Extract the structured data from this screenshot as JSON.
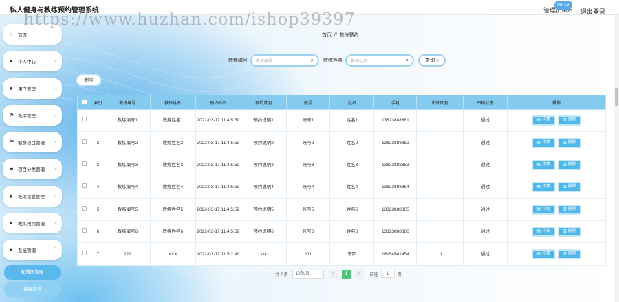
{
  "app": {
    "title": "私人健身与教练预约管理系统",
    "user_label": "管理员abo",
    "badge": "05:19",
    "logout": "退出登录",
    "watermark": "https://www.huzhan.com/ishop39397"
  },
  "sidebar": {
    "items": [
      {
        "label": "首页",
        "icon": "home-icon"
      },
      {
        "label": "个人中心",
        "icon": "person-icon"
      },
      {
        "label": "用户管理",
        "icon": "grid-icon"
      },
      {
        "label": "教练管理",
        "icon": "flag-icon"
      },
      {
        "label": "健身项目管理",
        "icon": "list-icon"
      },
      {
        "label": "项目分类管理",
        "icon": "box-icon"
      },
      {
        "label": "教练信息管理",
        "icon": "grid-icon"
      },
      {
        "label": "教练预约管理",
        "icon": "grid-icon"
      },
      {
        "label": "系统管理",
        "icon": "person-icon"
      }
    ],
    "sub_items": [
      "轮播图管理",
      "健身资讯"
    ]
  },
  "breadcrumb": {
    "home": "首页",
    "sep": "//",
    "current": "教练预约"
  },
  "search": {
    "label1": "教练编号",
    "placeholder1": "教练编号",
    "label2": "教练姓名",
    "placeholder2": "教练姓名",
    "query": "查询"
  },
  "toolbar": {
    "delete": "删除"
  },
  "table": {
    "headers": [
      "索引",
      "教练编号",
      "教练姓名",
      "预约时间",
      "预约说明",
      "账号",
      "姓名",
      "手机",
      "审核回复",
      "审核状态",
      "操作"
    ],
    "rows": [
      {
        "index": "1",
        "coach_no": "教练编号1",
        "coach_name": "教练姓名1",
        "time": "2022-03-17 11:4 5:59",
        "desc": "预约说明1",
        "account": "账号1",
        "name": "姓名1",
        "phone": "13823888881",
        "reply": "",
        "status": "通过"
      },
      {
        "index": "2",
        "coach_no": "教练编号2",
        "coach_name": "教练姓名2",
        "time": "2022-03-17 11:4 5:59",
        "desc": "预约说明2",
        "account": "账号2",
        "name": "姓名2",
        "phone": "13823888882",
        "reply": "",
        "status": "通过"
      },
      {
        "index": "3",
        "coach_no": "教练编号3",
        "coach_name": "教练姓名3",
        "time": "2022-03-17 11:4 5:59",
        "desc": "预约说明3",
        "account": "账号3",
        "name": "姓名3",
        "phone": "13823888883",
        "reply": "",
        "status": "通过"
      },
      {
        "index": "4",
        "coach_no": "教练编号4",
        "coach_name": "教练姓名4",
        "time": "2022-03-17 11:4 5:59",
        "desc": "预约说明4",
        "account": "账号4",
        "name": "姓名4",
        "phone": "13823888884",
        "reply": "",
        "status": "通过"
      },
      {
        "index": "5",
        "coach_no": "教练编号5",
        "coach_name": "教练姓名5",
        "time": "2022-03-17 11:4 5:59",
        "desc": "预约说明5",
        "account": "账号5",
        "name": "姓名5",
        "phone": "13823888885",
        "reply": "",
        "status": "通过"
      },
      {
        "index": "6",
        "coach_no": "教练编号6",
        "coach_name": "教练姓名6",
        "time": "2022-03-17 11:4 5:59",
        "desc": "预约说明6",
        "account": "账号6",
        "name": "姓名6",
        "phone": "13823888886",
        "reply": "",
        "status": "通过"
      },
      {
        "index": "7",
        "coach_no": "222",
        "coach_name": "XXX",
        "time": "2022-03-17 11:5 2:49",
        "desc": "xxx",
        "account": "111",
        "name": "李四",
        "phone": "18154541454",
        "reply": "11",
        "status": "通过"
      }
    ],
    "detail_label": "详情",
    "delete_label": "删除"
  },
  "pager": {
    "total": "共 7 条",
    "page_size": "10条/页",
    "prev": "‹",
    "current": "1",
    "next": "›",
    "goto": "前往",
    "goto_value": "1",
    "page_unit": "页"
  },
  "colors": {
    "accent": "#4fb8ea",
    "header": "#84cbef",
    "page_active": "#4fc27c"
  }
}
